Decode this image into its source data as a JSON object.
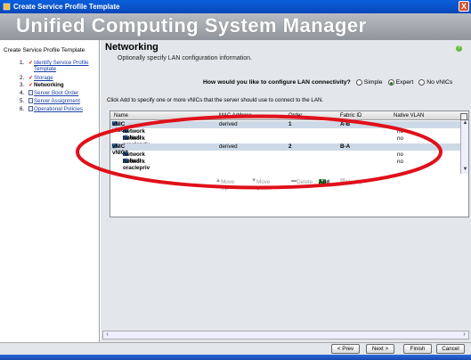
{
  "window": {
    "title": "Create Service Profile Template",
    "close_label": "X"
  },
  "banner": {
    "app_title": "Unified Computing System Manager"
  },
  "leftnav": {
    "header": "Create Service Profile Template",
    "steps": [
      {
        "num": "1.",
        "label": "Identify Service Profile Template",
        "done": true
      },
      {
        "num": "2.",
        "label": "Storage",
        "done": true
      },
      {
        "num": "3.",
        "label": "Networking",
        "done": true,
        "current": true
      },
      {
        "num": "4.",
        "label": "Server Boot Order"
      },
      {
        "num": "5.",
        "label": "Server Assignment"
      },
      {
        "num": "6.",
        "label": "Operational Policies"
      }
    ]
  },
  "main": {
    "title": "Networking",
    "subtitle": "Optionally specify LAN configuration information.",
    "question": "How would you like to configure LAN connectivity?",
    "options": [
      "Simple",
      "Expert",
      "No vNICs"
    ],
    "selected_option": "Expert",
    "hint": "Click Add to specify one or more vNICs that the server should use to connect to the LAN."
  },
  "table": {
    "columns": [
      "Name",
      "MAC Address",
      "Order",
      "Fabric ID",
      "Native VLAN"
    ],
    "rows": [
      {
        "name": "vNIC vNIC1",
        "mac": "derived",
        "order": "1",
        "fabric": "A-B",
        "vlan": ""
      },
      {
        "name": "Network default",
        "mac": "",
        "order": "",
        "fabric": "",
        "vlan": "no"
      },
      {
        "name": "Network oraclepriv",
        "mac": "",
        "order": "",
        "fabric": "",
        "vlan": "no"
      },
      {
        "name": "vNIC vNIC2",
        "mac": "derived",
        "order": "2",
        "fabric": "B-A",
        "vlan": ""
      },
      {
        "name": "Network default",
        "mac": "",
        "order": "",
        "fabric": "",
        "vlan": "no"
      },
      {
        "name": "Network oraclepriv",
        "mac": "",
        "order": "",
        "fabric": "",
        "vlan": "no"
      }
    ]
  },
  "toolbar": {
    "move_up": "Move Up",
    "move_down": "Move Down",
    "delete": "Delete",
    "add": "Add",
    "modify": "Modify"
  },
  "buttons": {
    "prev": "< Prev",
    "next": "Next >",
    "finish": "Finish",
    "cancel": "Cancel"
  },
  "colors": {
    "annotation": "#e0101a",
    "titlebar": "#0a5fdc",
    "selected_row": "#cdd9e6"
  }
}
